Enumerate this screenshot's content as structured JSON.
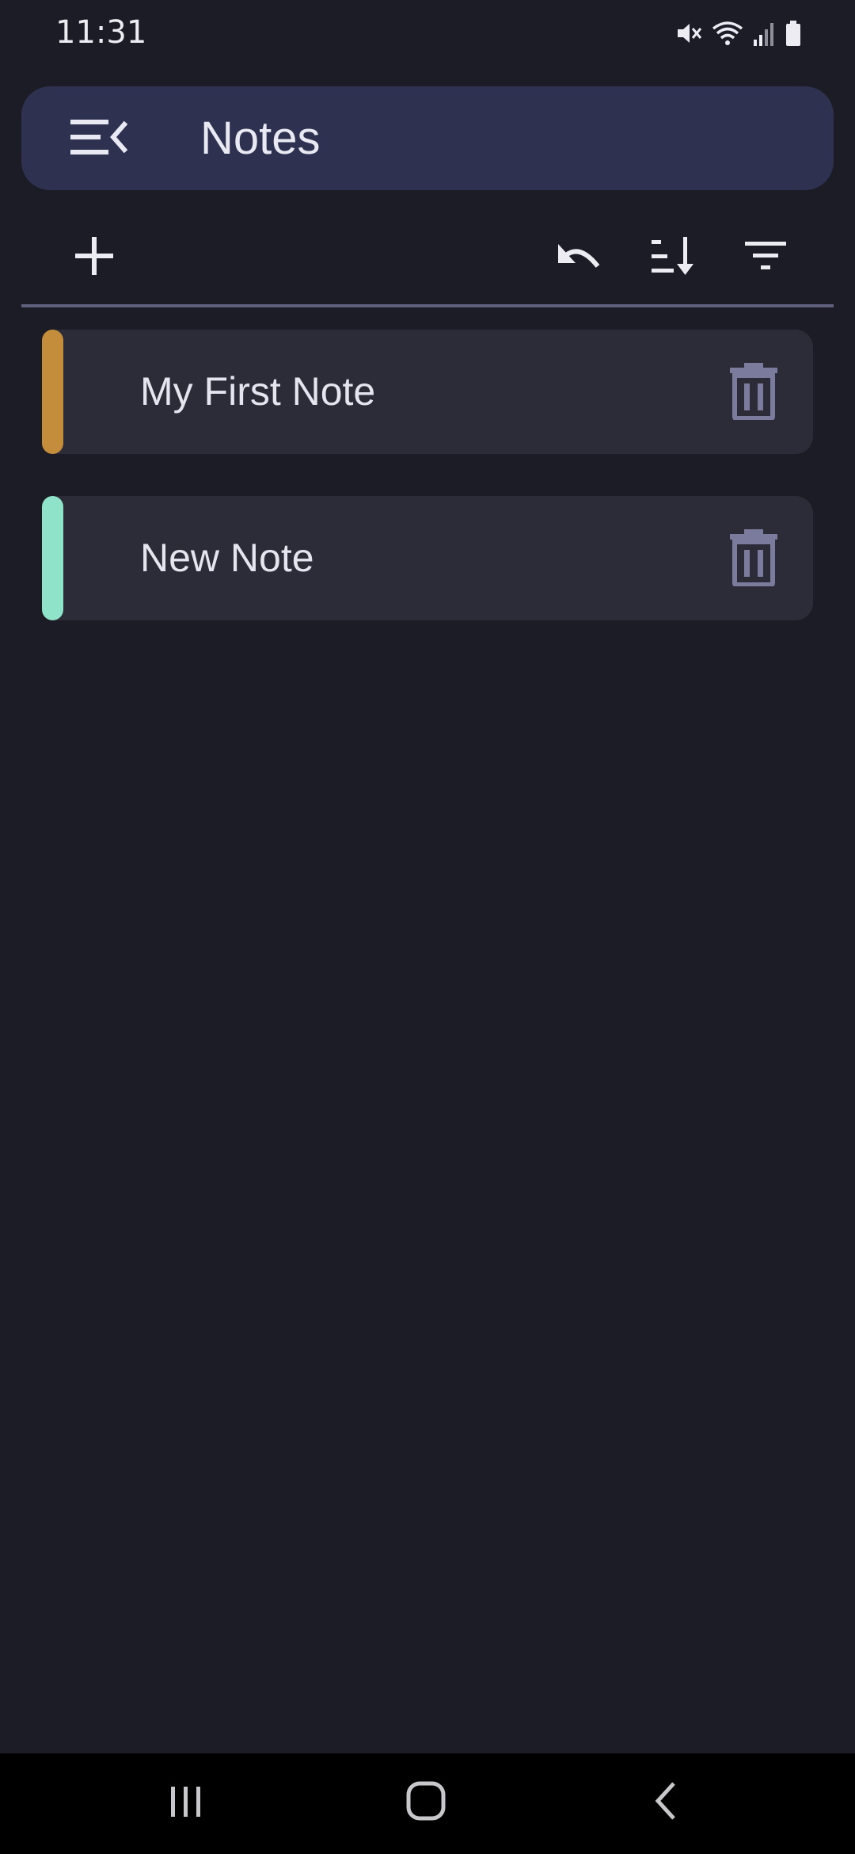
{
  "status_bar": {
    "time": "11:31",
    "icons": [
      "mute-icon",
      "wifi-icon",
      "signal-icon",
      "battery-icon"
    ]
  },
  "app_bar": {
    "title": "Notes",
    "menu_icon": "menu-collapse-icon"
  },
  "toolbar": {
    "add_icon": "plus-icon",
    "undo_icon": "undo-icon",
    "sort_icon": "sort-icon",
    "filter_icon": "filter-icon"
  },
  "notes": [
    {
      "title": "My First Note",
      "color": "#c48d3c"
    },
    {
      "title": "New Note",
      "color": "#8ee3c8"
    }
  ],
  "nav_bar": {
    "icons": [
      "recents-icon",
      "home-icon",
      "back-icon"
    ]
  },
  "colors": {
    "background": "#1b1c25",
    "app_bar": "#2f3150",
    "card": "#2c2c38",
    "delete_icon": "#7b7b9e"
  }
}
